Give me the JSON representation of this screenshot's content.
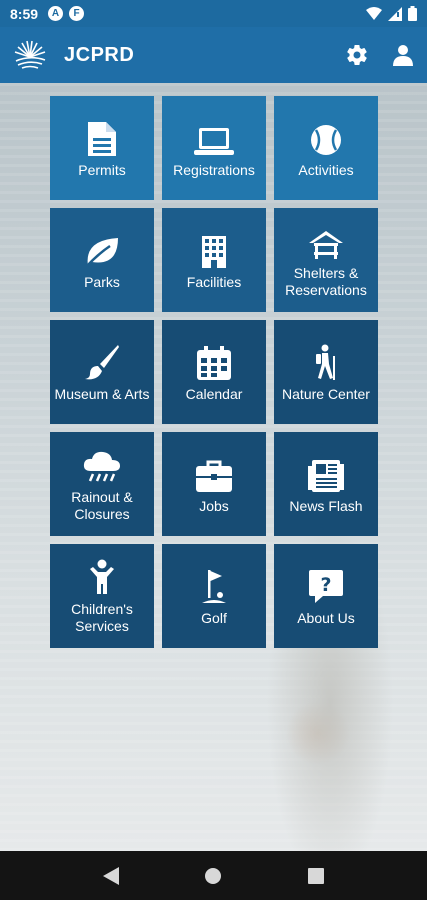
{
  "status_bar": {
    "time": "8:59",
    "badges": [
      "A",
      "F"
    ]
  },
  "app_bar": {
    "title": "JCPRD",
    "icons": [
      "settings-icon",
      "profile-icon"
    ]
  },
  "tiles": [
    {
      "label": "Permits",
      "icon": "document-icon"
    },
    {
      "label": "Registrations",
      "icon": "laptop-icon"
    },
    {
      "label": "Activities",
      "icon": "baseball-icon"
    },
    {
      "label": "Parks",
      "icon": "leaf-icon"
    },
    {
      "label": "Facilities",
      "icon": "building-icon"
    },
    {
      "label": "Shelters & Reservations",
      "icon": "shelter-icon"
    },
    {
      "label": "Museum & Arts",
      "icon": "paintbrush-icon"
    },
    {
      "label": "Calendar",
      "icon": "calendar-icon"
    },
    {
      "label": "Nature Center",
      "icon": "hiker-icon"
    },
    {
      "label": "Rainout & Closures",
      "icon": "rain-cloud-icon"
    },
    {
      "label": "Jobs",
      "icon": "briefcase-icon"
    },
    {
      "label": "News Flash",
      "icon": "newspaper-icon"
    },
    {
      "label": "Children's Services",
      "icon": "child-icon"
    },
    {
      "label": "Golf",
      "icon": "golf-icon"
    },
    {
      "label": "About Us",
      "icon": "question-icon"
    }
  ],
  "colors": {
    "app_bar": "#1f6ea7",
    "tile": "#1c5d8c",
    "tile_light": "#2277ad",
    "nav_bar": "#141414"
  }
}
